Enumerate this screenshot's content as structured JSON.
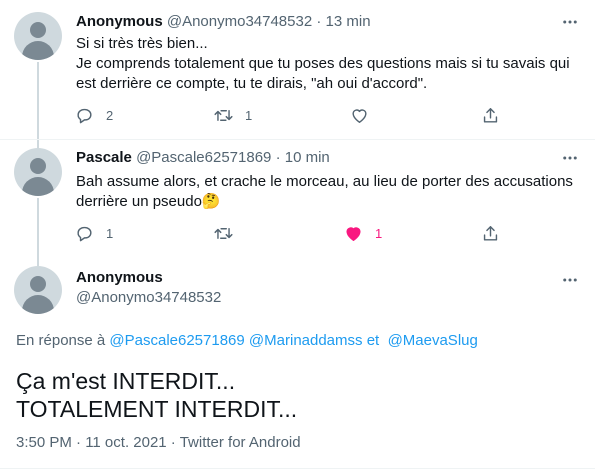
{
  "tweets": [
    {
      "name": "Anonymous",
      "handle": "@Anonymo34748532",
      "separator": " · ",
      "time": "13 min",
      "lines": [
        "Si si très très bien...",
        "Je comprends totalement que tu poses des questions mais si tu savais qui",
        "est derrière ce compte, tu te dirais, \"ah oui d'accord\"."
      ],
      "actions": {
        "reply_count": "2",
        "retweet_count": "1",
        "like_count": ""
      }
    },
    {
      "name": "Pascale",
      "handle": "@Pascale62571869",
      "separator": " · ",
      "time": "10 min",
      "lines": [
        "Bah assume alors, et crache le morceau, au lieu de porter des accusations",
        "derrière un pseudo"
      ],
      "emoji": "🤔",
      "actions": {
        "reply_count": "1",
        "retweet_count": "",
        "like_count": "1",
        "liked": true
      }
    }
  ],
  "main_tweet": {
    "name": "Anonymous",
    "handle": "@Anonymo34748532",
    "reply_prefix": "En réponse à ",
    "mentions": [
      "@Pascale62571869",
      "@Marinaddamss",
      "@MaevaSlug"
    ],
    "mention_joiner": " et ",
    "text_lines": [
      "Ça m'est INTERDIT...",
      "TOTALEMENT INTERDIT..."
    ],
    "timestamp": "3:50 PM · 11 oct. 2021 · Twitter for Android"
  },
  "colors": {
    "accent": "#1d9bf0",
    "like": "#f91880",
    "secondary_text": "#536471",
    "divider": "#eff3f4",
    "avatar_bg": "#cfd9de"
  },
  "icons": [
    "more-icon",
    "reply-icon",
    "retweet-icon",
    "like-icon",
    "share-icon"
  ]
}
